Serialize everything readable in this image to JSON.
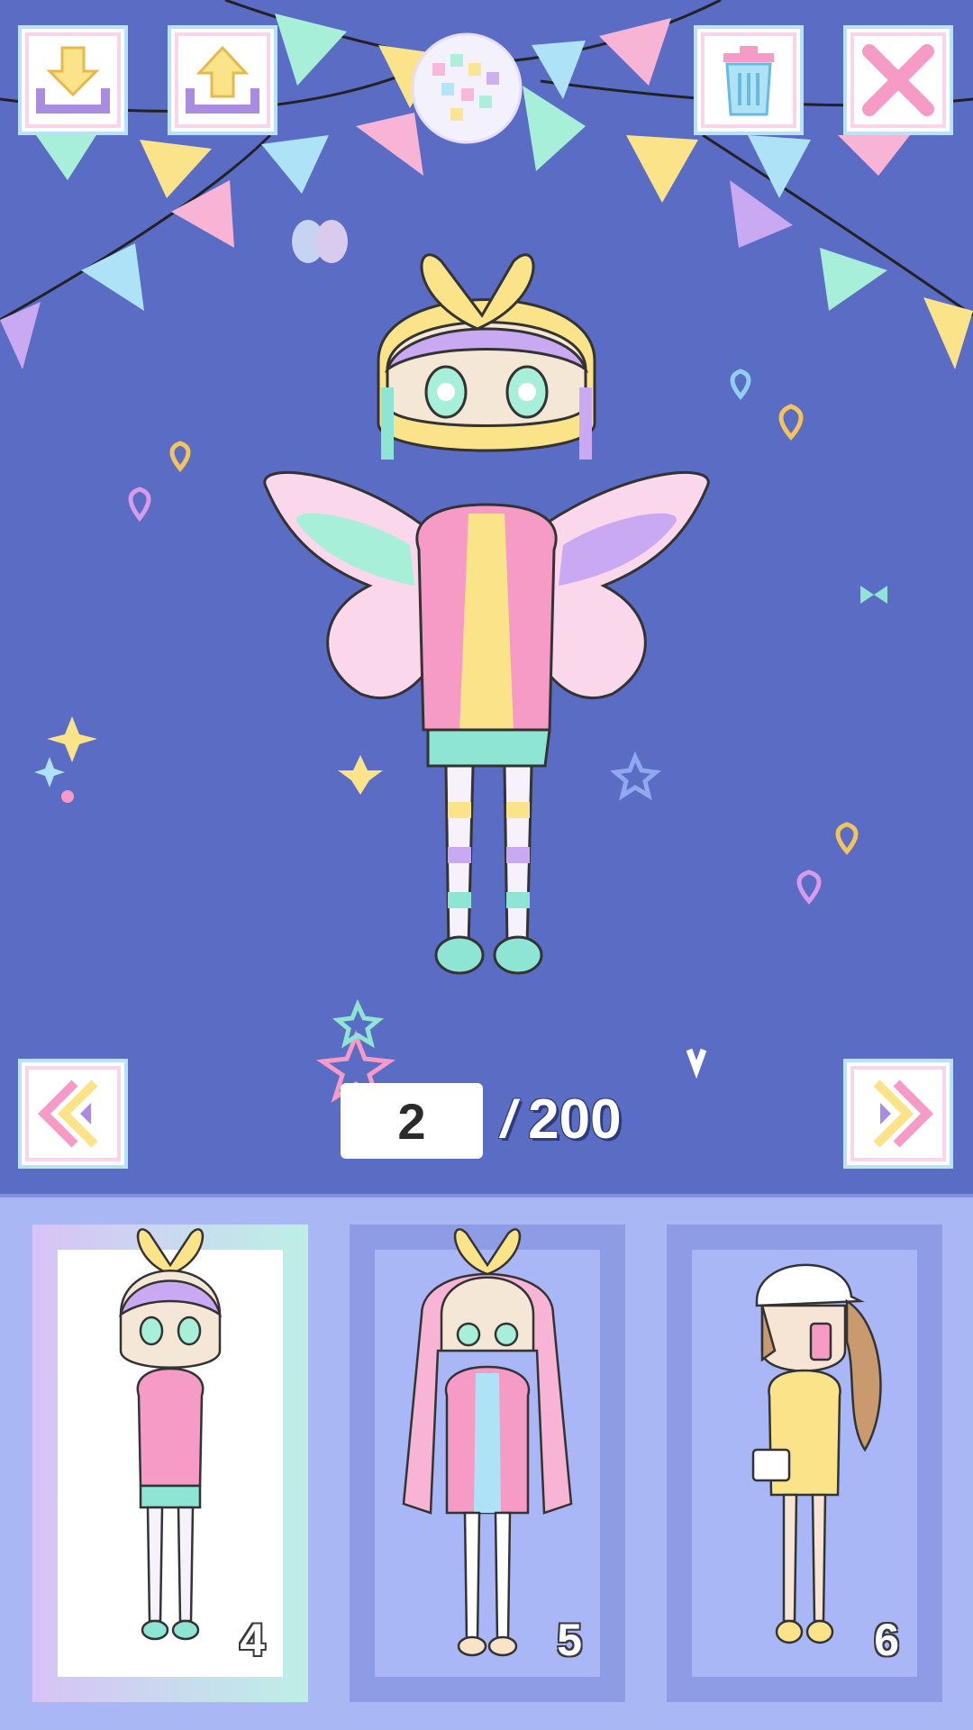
{
  "toolbar": {
    "import_icon": "download-arrow-icon",
    "export_icon": "upload-arrow-icon",
    "delete_icon": "trash-icon",
    "close_icon": "close-x-icon"
  },
  "pager": {
    "current_page": "2",
    "separator": "/",
    "total_pages": "200",
    "prev_icon": "double-chevron-left-icon",
    "next_icon": "double-chevron-right-icon"
  },
  "slots": [
    {
      "number": "4",
      "selected": true
    },
    {
      "number": "5",
      "selected": false
    },
    {
      "number": "6",
      "selected": false
    }
  ],
  "colors": {
    "background": "#5A6CC3",
    "shelf": "#AAB7F5",
    "accent_pink": "#F69BC6",
    "accent_yellow": "#FBE38A",
    "accent_mint": "#8EE5D3",
    "accent_lilac": "#C8A9F2"
  }
}
